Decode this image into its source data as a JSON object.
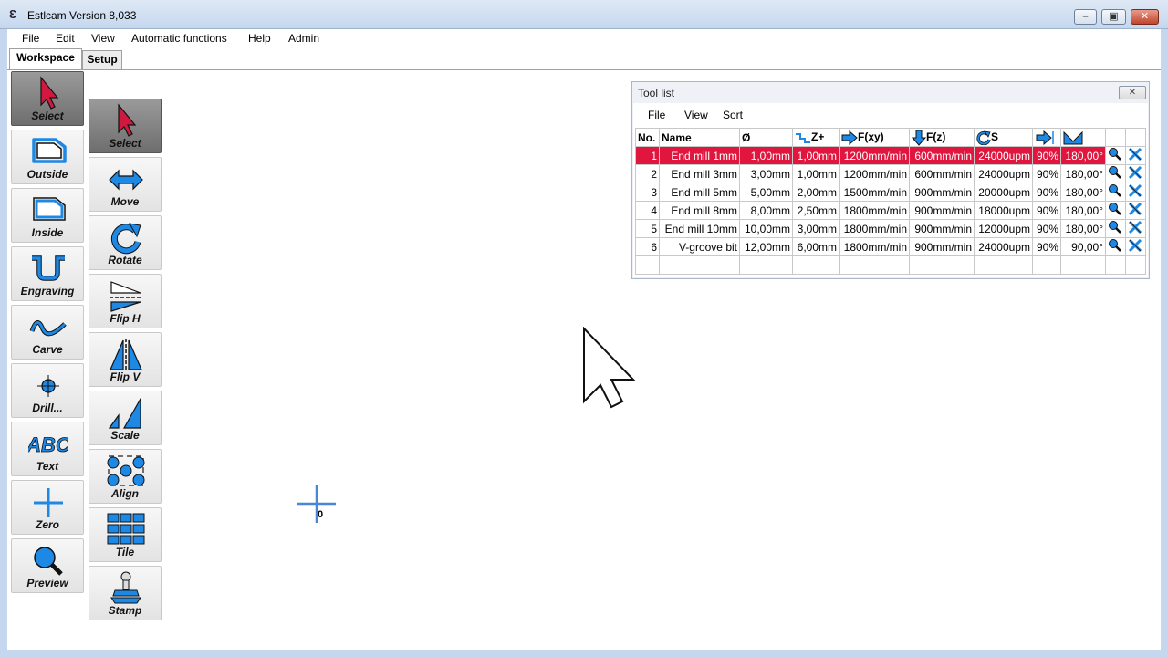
{
  "window": {
    "title": "Estlcam Version 8,033"
  },
  "menu": [
    "File",
    "Edit",
    "View",
    "Automatic functions",
    "Help",
    "Admin"
  ],
  "tabs": {
    "workspace": "Workspace",
    "setup": "Setup"
  },
  "left_tools": [
    {
      "label": "Select",
      "icon": "select-arrow-icon"
    },
    {
      "label": "Outside",
      "icon": "outside-contour-icon"
    },
    {
      "label": "Inside",
      "icon": "inside-contour-icon"
    },
    {
      "label": "Engraving",
      "icon": "engraving-icon"
    },
    {
      "label": "Carve",
      "icon": "carve-icon"
    },
    {
      "label": "Drill...",
      "icon": "drill-icon"
    },
    {
      "label": "Text",
      "icon": "text-icon"
    },
    {
      "label": "Zero",
      "icon": "zero-icon"
    },
    {
      "label": "Preview",
      "icon": "preview-icon"
    }
  ],
  "right_tools": [
    {
      "label": "Select",
      "icon": "select-arrow-icon"
    },
    {
      "label": "Move",
      "icon": "move-icon"
    },
    {
      "label": "Rotate",
      "icon": "rotate-icon"
    },
    {
      "label": "Flip H",
      "icon": "flip-h-icon"
    },
    {
      "label": "Flip V",
      "icon": "flip-v-icon"
    },
    {
      "label": "Scale",
      "icon": "scale-icon"
    },
    {
      "label": "Align",
      "icon": "align-icon"
    },
    {
      "label": "Tile",
      "icon": "tile-icon"
    },
    {
      "label": "Stamp",
      "icon": "stamp-icon"
    }
  ],
  "tool_list": {
    "title": "Tool list",
    "menu": [
      "File",
      "View",
      "Sort"
    ],
    "headers": {
      "no": "No.",
      "name": "Name",
      "diameter": "Ø",
      "zplus": "Z+",
      "fxy": "F(xy)",
      "fz": "F(z)",
      "s": "S"
    },
    "rows": [
      {
        "no": "1",
        "name": "End mill 1mm",
        "dia": "1,00mm",
        "z": "1,00mm",
        "fxy": "1200mm/min",
        "fz": "600mm/min",
        "s": "24000upm",
        "pct": "90%",
        "angle": "180,00°"
      },
      {
        "no": "2",
        "name": "End mill 3mm",
        "dia": "3,00mm",
        "z": "1,00mm",
        "fxy": "1200mm/min",
        "fz": "600mm/min",
        "s": "24000upm",
        "pct": "90%",
        "angle": "180,00°"
      },
      {
        "no": "3",
        "name": "End mill 5mm",
        "dia": "5,00mm",
        "z": "2,00mm",
        "fxy": "1500mm/min",
        "fz": "900mm/min",
        "s": "20000upm",
        "pct": "90%",
        "angle": "180,00°"
      },
      {
        "no": "4",
        "name": "End mill 8mm",
        "dia": "8,00mm",
        "z": "2,50mm",
        "fxy": "1800mm/min",
        "fz": "900mm/min",
        "s": "18000upm",
        "pct": "90%",
        "angle": "180,00°"
      },
      {
        "no": "5",
        "name": "End mill 10mm",
        "dia": "10,00mm",
        "z": "3,00mm",
        "fxy": "1800mm/min",
        "fz": "900mm/min",
        "s": "12000upm",
        "pct": "90%",
        "angle": "180,00°"
      },
      {
        "no": "6",
        "name": "V-groove bit",
        "dia": "12,00mm",
        "z": "6,00mm",
        "fxy": "1800mm/min",
        "fz": "900mm/min",
        "s": "24000upm",
        "pct": "90%",
        "angle": "90,00°"
      }
    ]
  },
  "canvas": {
    "origin_label": "0"
  },
  "colors": {
    "accent_blue": "#1e88e5",
    "selected_row": "#e0163f",
    "select_arrow": "#d0193f"
  }
}
